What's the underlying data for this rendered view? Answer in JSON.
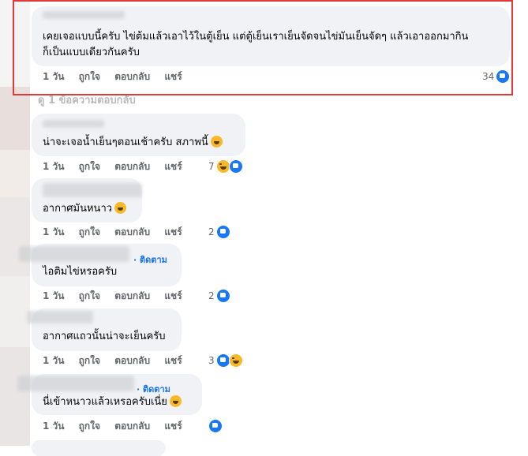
{
  "colors": {
    "highlight": "#e0393a",
    "link": "#1b74e4",
    "meta": "#65676b",
    "bubble": "#f0f2f5"
  },
  "main_comment": {
    "line1": "เคยเจอแบบนี้ครับ ไข่ต้มแล้วเอาไว้ในตู้เย็น แต่ตู้เย็นเราเย็นจัดจนไข่มันเย็นจัดๆ แล้วเอาออกมากิน",
    "line2": "ก็เป็นแบบเดียวกันครับ",
    "time": "1 วัน",
    "like": "ถูกใจ",
    "reply": "ตอบกลับ",
    "share": "แชร์",
    "reactions": "34"
  },
  "reply_summary": "ดู 1 ข้อความตอบกลับ",
  "replies": [
    {
      "text": "น่าจะเจอน้ำเย็นๆตอนเช้าครับ สภาพนี้",
      "follow": "",
      "time": "1 วัน",
      "like": "ถูกใจ",
      "reply": "ตอบกลับ",
      "share": "แชร์",
      "reactions": "7"
    },
    {
      "text": "อากาศมันหนาว",
      "follow": "",
      "time": "1 วัน",
      "like": "ถูกใจ",
      "reply": "ตอบกลับ",
      "share": "แชร์",
      "reactions": "2"
    },
    {
      "text": "ไอติมไข่หรอครับ",
      "follow": "ติดตาม",
      "time": "1 วัน",
      "like": "ถูกใจ",
      "reply": "ตอบกลับ",
      "share": "แชร์",
      "reactions": "2"
    },
    {
      "text": "อากาศแถวนั้นน่าจะเย็นครับ",
      "follow": "",
      "time": "1 วัน",
      "like": "ถูกใจ",
      "reply": "ตอบกลับ",
      "share": "แชร์",
      "reactions": "3"
    },
    {
      "text": "นี่เข้าหนาวแล้วเหรอครับเนี่ย",
      "follow": "ติดตาม",
      "time": "1 วัน",
      "like": "ถูกใจ",
      "reply": "ตอบกลับ",
      "share": "แชร์",
      "reactions": ""
    }
  ]
}
